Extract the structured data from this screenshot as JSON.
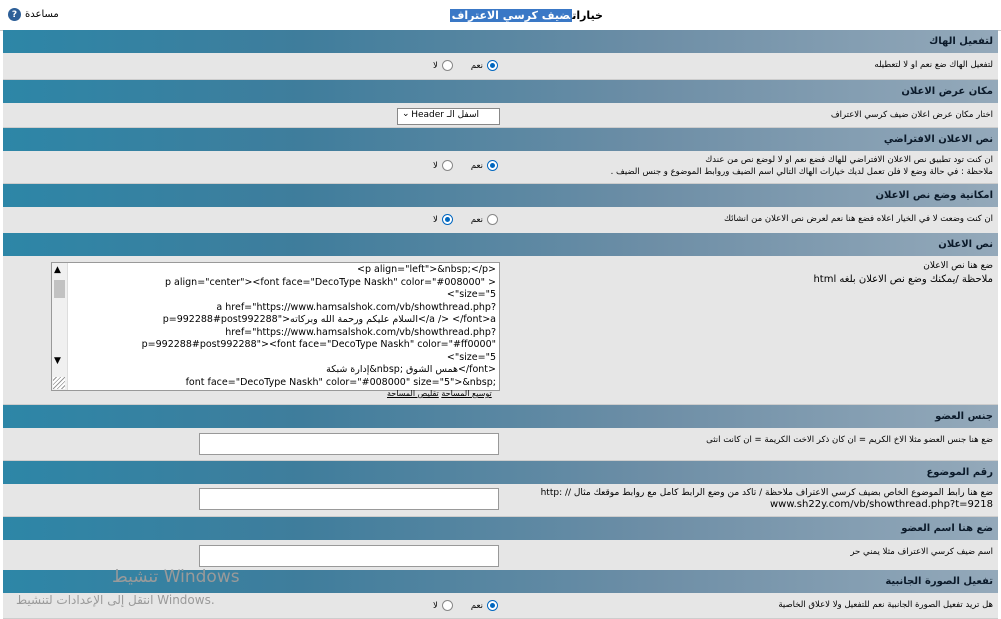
{
  "window": {
    "title_prefix": "خيارات",
    "title_highlight": "ضيف كرسي الاعتراف",
    "help_label": "مساعدة",
    "help_icon": "?"
  },
  "sections": [
    {
      "header": "لتفعيل الهاك",
      "description": "لتفعيل الهاك ضع نعم او لا لتعطيله",
      "yes": "نعم",
      "no": "لا",
      "selected": "yes"
    },
    {
      "header": "مكان عرض الاعلان",
      "description": "اختار مكان عرض اعلان ضيف كرسي الاعتراف",
      "select_value": "اسفل الـ Header",
      "select_icon": "chevron-down"
    },
    {
      "header": "نص الاعلان الافتراضي",
      "description_lines": [
        "ان كنت تود تطبيق نص الاعلان الافتراضي للهاك فضع نعم او لا لوضع نص من عندك",
        "ملاحظة : في حالة وضع لا فلن تعمل لديك خيارات الهاك التالي اسم الضيف وروابط الموضوع و جنس الضيف ."
      ],
      "yes": "نعم",
      "no": "لا",
      "selected": "yes"
    },
    {
      "header": "امكانية وضع نص الاعلان",
      "description": "ان كنت وضعت لا في الخيار اعلاه فضع هنا نعم لعرض نص الاعلان من انشائك",
      "yes": "نعم",
      "no": "لا",
      "selected": "no"
    },
    {
      "header": "نص الاعلان",
      "description_lines": [
        "ضع هنا نص الاعلان",
        "ملاحظة /يمكنك وضع نص الاعلان بلغه html"
      ],
      "textarea_lines": [
        "<p align=\"left\">&nbsp;</p>",
        "p align=\"center\"><font face=\"DecoType Naskh\" color=\"#008000\" >",
        "<\"size=\"5",
        "a href=\"https://www.hamsalshok.com/vb/showthread.php?",
        "p=992288#post992288\">السلام عليكم ورحمة الله وبركاته</a /> </font>a",
        "href=\"https://www.hamsalshok.com/vb/showthread.php?",
        "p=992288#post992288\"><font face=\"DecoType Naskh\" color=\"#ff0000\"",
        "<\"size=\"5",
        "إدارة شبكة&nbsp; همس الشوق</font>",
        "font face=\"DecoType Naskh\" color=\"#008000\" size=\"5\">&nbsp;"
      ],
      "expand_label": "توسيع المساحة",
      "shrink_label": "تقليص المساحة"
    },
    {
      "header": "جنس العضو",
      "description": "ضع هنا جنس العضو مثلا الاخ الكريم = ان كان ذكر الاخت الكريمة = ان كانت انثى",
      "input_value": ""
    },
    {
      "header": "رقم الموضوع",
      "description_lines": [
        "ضع هنا رابط الموضوع الخاص بضيف كرسي الاعتراف ملاحظة / تاكد من وضع الرابط كامل مع روابط موقعك مثال // :http",
        "www.sh22y.com/vb/showthread.php?t=9218"
      ],
      "input_value": ""
    },
    {
      "header": "ضع هنا اسم العضو",
      "description": "اسم ضيف كرسي الاعتراف مثلا يمني حر",
      "input_value": ""
    },
    {
      "header": "تفعيل الصورة الجانبية",
      "description": "هل تريد تفعيل الصورة الجانبية نعم للتفعيل ولا لاعلاق الخاصية",
      "yes": "نعم",
      "no": "لا",
      "selected": "yes"
    }
  ],
  "watermark": {
    "title": "تنشيط Windows",
    "subtitle": "انتقل إلى الإعدادات لتنشيط Windows."
  }
}
